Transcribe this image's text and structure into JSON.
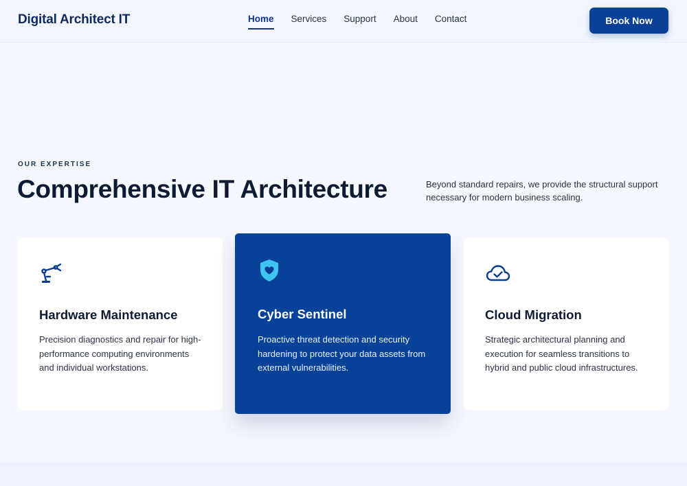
{
  "header": {
    "brand": "Digital Architect IT",
    "nav": [
      "Home",
      "Services",
      "Support",
      "About",
      "Contact"
    ],
    "active_nav": "Home",
    "cta_label": "Book Now"
  },
  "section": {
    "eyebrow": "OUR EXPERTISE",
    "title": "Comprehensive IT Architecture",
    "description": "Beyond standard repairs, we provide the structural support necessary for modern business scaling."
  },
  "cards": [
    {
      "icon": "robotic-arm-icon",
      "title": "Hardware Maintenance",
      "text": "Precision diagnostics and repair for high-performance computing environments and individual workstations."
    },
    {
      "icon": "shield-heart-icon",
      "title": "Cyber Sentinel",
      "text": "Proactive threat detection and security hardening to protect your data assets from external vulnerabilities."
    },
    {
      "icon": "cloud-check-icon",
      "title": "Cloud Migration",
      "text": "Strategic architectural planning and execution for seamless transitions to hybrid and public cloud infrastructures."
    }
  ],
  "colors": {
    "primary": "#0a4197",
    "featured_card": "#064297",
    "accent_icon": "#3fc3f0",
    "page_bg": "#f5f8fe",
    "text_dark": "#0f1b33"
  }
}
